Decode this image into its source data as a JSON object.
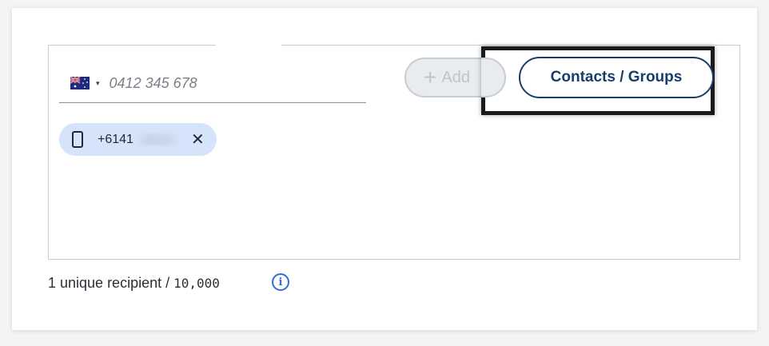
{
  "phone_field": {
    "country": "Australia",
    "placeholder": "0412 345 678",
    "caret": "▾"
  },
  "add_button": {
    "label": "Add",
    "plus": "+"
  },
  "contacts_button": {
    "label": "Contacts / Groups"
  },
  "recipient_chip": {
    "number": "+6141",
    "remove": "✕",
    "icon": "mobile-phone-icon"
  },
  "counter": {
    "text": "1 unique recipient / ",
    "max": "10,000"
  },
  "info": {
    "glyph": "i",
    "icon": "info-icon"
  },
  "colors": {
    "primary": "#183e6b",
    "chip_bg": "#d6e4fb",
    "info": "#2f6fd6",
    "highlight_border": "#1a1a1a"
  }
}
